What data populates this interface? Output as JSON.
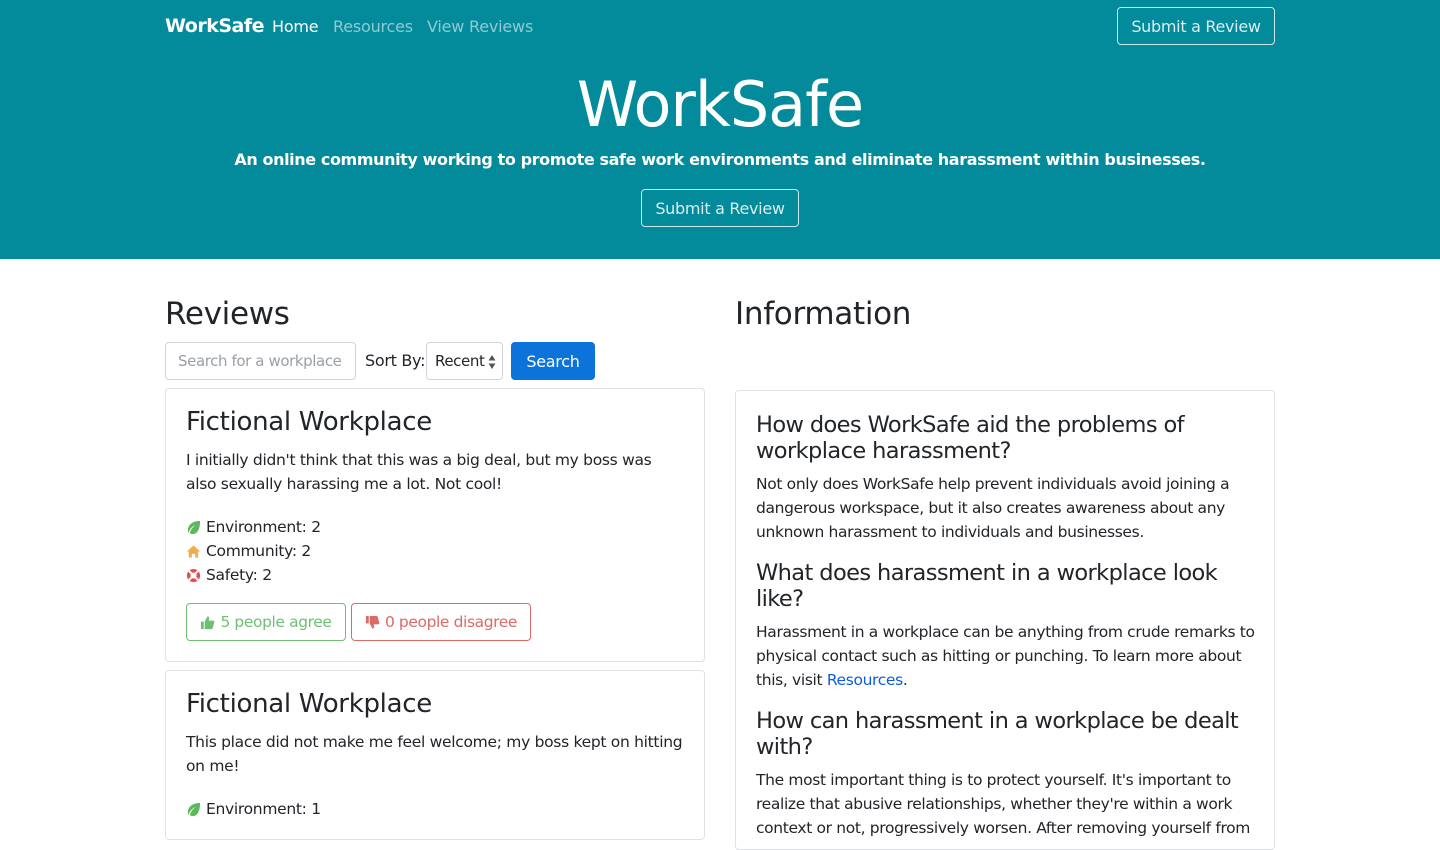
{
  "nav": {
    "brand": "WorkSafe",
    "links": [
      "Home",
      "Resources",
      "View Reviews"
    ],
    "submit_label": "Submit a Review"
  },
  "hero": {
    "title": "WorkSafe",
    "subtitle": "An online community working to promote safe work environments and eliminate harassment within businesses.",
    "submit_label": "Submit a Review"
  },
  "reviews": {
    "heading": "Reviews",
    "search_placeholder": "Search for a workplace...",
    "sort_label": "Sort By:",
    "sort_value": "Recent",
    "search_button": "Search",
    "items": [
      {
        "title": "Fictional Workplace",
        "text": "I initially didn't think that this was a big deal, but my boss was also sexually harassing me a lot. Not cool!",
        "environment": "Environment: 2",
        "community": "Community: 2",
        "safety": "Safety: 2",
        "agree": "5 people agree",
        "disagree": "0 people disagree"
      },
      {
        "title": "Fictional Workplace",
        "text": "This place did not make me feel welcome; my boss kept on hitting on me!",
        "environment": "Environment: 1"
      }
    ]
  },
  "information": {
    "heading": "Information",
    "qa": [
      {
        "q": "How does WorkSafe aid the problems of workplace harassment?",
        "a": "Not only does WorkSafe help prevent individuals avoid joining a dangerous workspace, but it also creates awareness about any unknown harassment to individuals and businesses."
      },
      {
        "q": "What does harassment in a workplace look like?",
        "a": "Harassment in a workplace can be anything from crude remarks to physical contact such as hitting or punching. To learn more about this, visit",
        "link": "Resources",
        "a_end": "."
      },
      {
        "q": "How can harassment in a workplace be dealt with?",
        "a": "The most important thing is to protect yourself. It's important to realize that abusive relationships, whether they're within a work context or not, progressively worsen. After removing yourself from"
      }
    ]
  },
  "colors": {
    "hero_bg": "#038a9b",
    "primary": "#0b73d9",
    "agree": "#6fbf73",
    "disagree": "#dc6a66",
    "environment_icon": "#5cb85c",
    "community_icon": "#f0ad4e",
    "safety_icon": "#d9534f"
  },
  "icons": [
    "leaf-icon",
    "home-icon",
    "life-ring-icon",
    "thumbs-up-icon",
    "thumbs-down-icon",
    "sort-arrows-icon"
  ]
}
